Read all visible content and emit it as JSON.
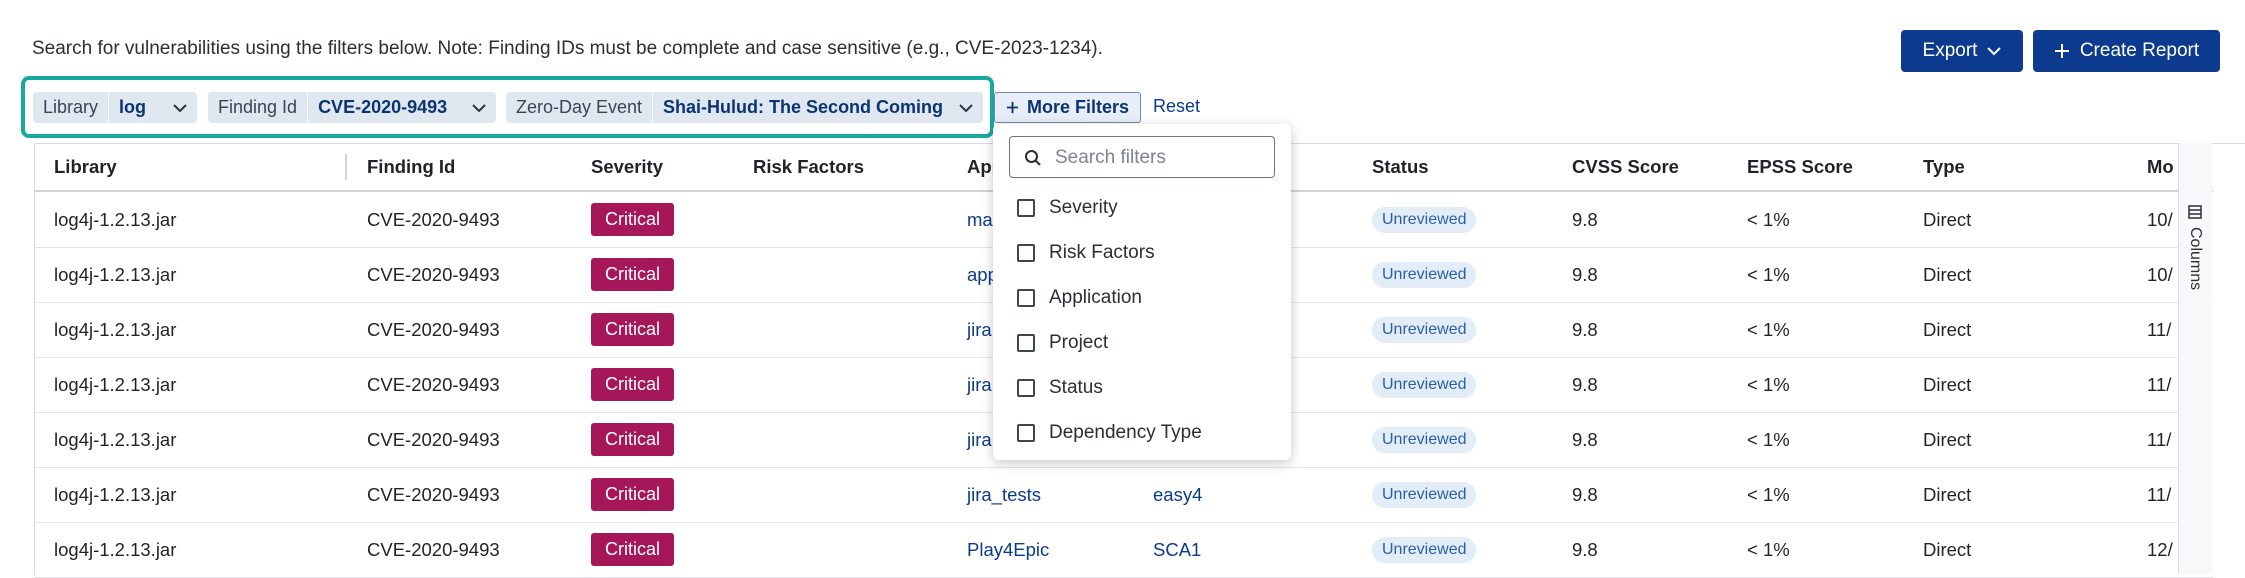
{
  "hint_text": "Search for vulnerabilities using the filters below. Note: Finding IDs must be complete and case sensitive (e.g., CVE-2023-1234).",
  "toolbar": {
    "export_label": "Export",
    "create_report_label": "Create Report"
  },
  "filters": {
    "library": {
      "label": "Library",
      "value": "log"
    },
    "finding_id": {
      "label": "Finding Id",
      "value": "CVE-2020-9493"
    },
    "zero_day": {
      "label": "Zero-Day Event",
      "value": "Shai-Hulud: The Second Coming"
    },
    "more_filters_label": "More Filters",
    "reset_label": "Reset"
  },
  "table": {
    "headers": [
      "Library",
      "Finding Id",
      "Severity",
      "Risk Factors",
      "App",
      "",
      "Status",
      "CVSS Score",
      "EPSS Score",
      "Type",
      "Mo"
    ],
    "rows": [
      {
        "library": "log4j-1.2.13.jar",
        "finding": "CVE-2020-9493",
        "severity": "Critical",
        "app": "ma",
        "project": "",
        "status": "Unreviewed",
        "cvss": "9.8",
        "epss": "< 1%",
        "type": "Direct",
        "mod": "10/"
      },
      {
        "library": "log4j-1.2.13.jar",
        "finding": "CVE-2020-9493",
        "severity": "Critical",
        "app": "app",
        "project": "",
        "status": "Unreviewed",
        "cvss": "9.8",
        "epss": "< 1%",
        "type": "Direct",
        "mod": "10/"
      },
      {
        "library": "log4j-1.2.13.jar",
        "finding": "CVE-2020-9493",
        "severity": "Critical",
        "app": "jira",
        "project": "",
        "status": "Unreviewed",
        "cvss": "9.8",
        "epss": "< 1%",
        "type": "Direct",
        "mod": "11/"
      },
      {
        "library": "log4j-1.2.13.jar",
        "finding": "CVE-2020-9493",
        "severity": "Critical",
        "app": "jira",
        "project": "",
        "status": "Unreviewed",
        "cvss": "9.8",
        "epss": "< 1%",
        "type": "Direct",
        "mod": "11/"
      },
      {
        "library": "log4j-1.2.13.jar",
        "finding": "CVE-2020-9493",
        "severity": "Critical",
        "app": "jira",
        "project": "",
        "status": "Unreviewed",
        "cvss": "9.8",
        "epss": "< 1%",
        "type": "Direct",
        "mod": "11/"
      },
      {
        "library": "log4j-1.2.13.jar",
        "finding": "CVE-2020-9493",
        "severity": "Critical",
        "app": "jira_tests",
        "project": "easy4",
        "status": "Unreviewed",
        "cvss": "9.8",
        "epss": "< 1%",
        "type": "Direct",
        "mod": "11/"
      },
      {
        "library": "log4j-1.2.13.jar",
        "finding": "CVE-2020-9493",
        "severity": "Critical",
        "app": "Play4Epic",
        "project": "SCA1",
        "status": "Unreviewed",
        "cvss": "9.8",
        "epss": "< 1%",
        "type": "Direct",
        "mod": "12/"
      }
    ]
  },
  "columns_rail_label": "Columns",
  "dropdown": {
    "search_placeholder": "Search filters",
    "options": [
      "Severity",
      "Risk Factors",
      "Application",
      "Project",
      "Status",
      "Dependency Type"
    ]
  },
  "colors": {
    "primary": "#0b3a8f",
    "focus_ring": "#17a8a0",
    "critical": "#a6175a"
  }
}
